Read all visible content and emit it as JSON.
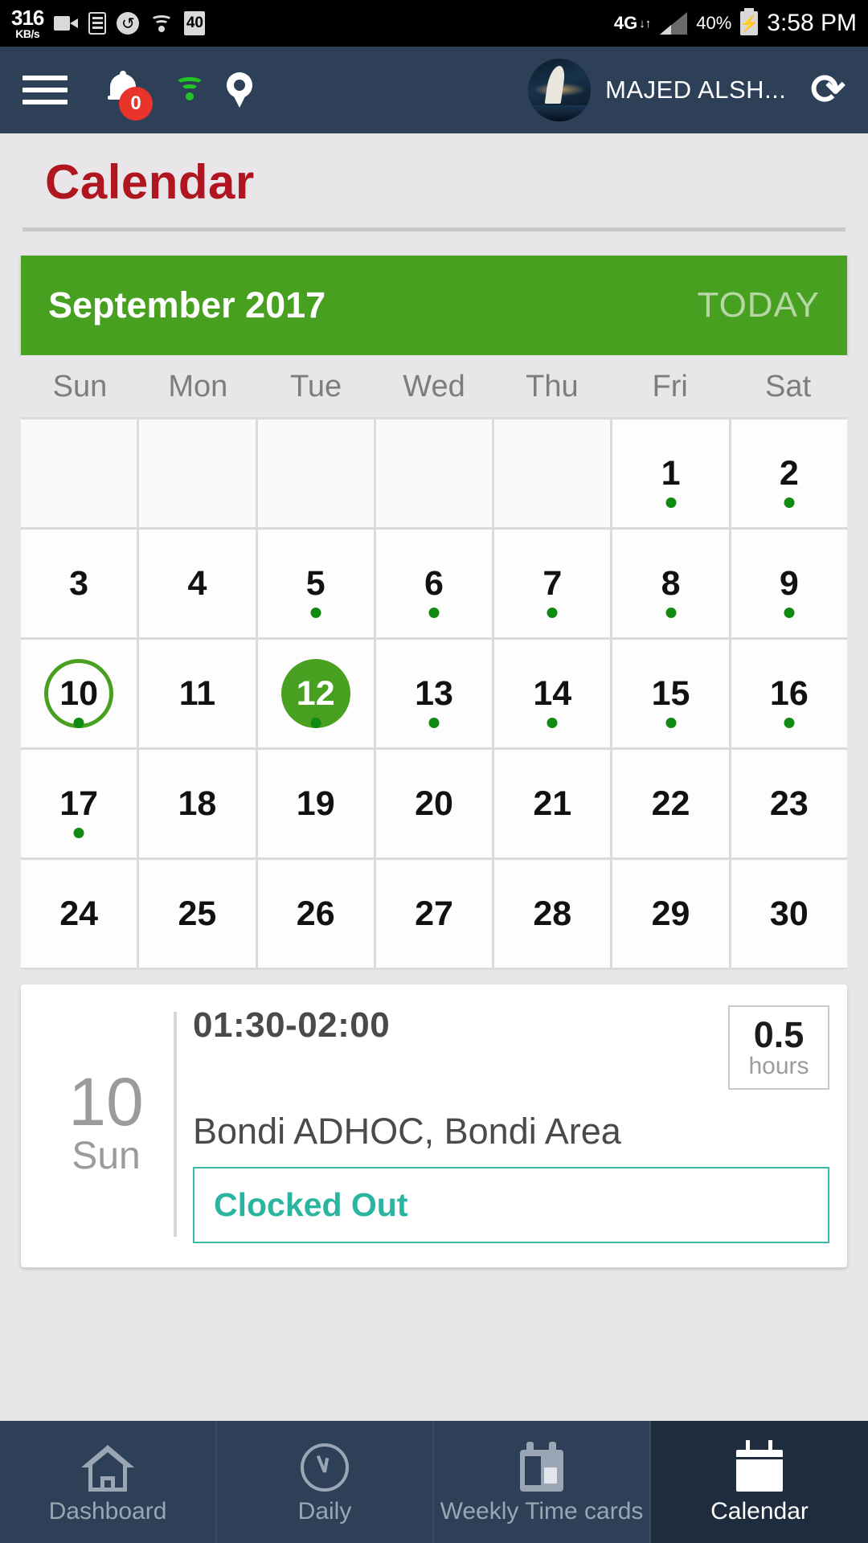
{
  "statusbar": {
    "net_speed_value": "316",
    "net_speed_unit": "KB/s",
    "icons": [
      "camera-icon",
      "list-icon",
      "sync-icon",
      "wifi-icon",
      "alarm-40-icon"
    ],
    "alarm_badge": "40",
    "network_type": "4G",
    "data_arrows": "↓↑",
    "battery_percent": "40%",
    "time": "3:58 PM"
  },
  "appbar": {
    "menu_icon": "hamburger-menu-icon",
    "notification_icon": "bell-icon",
    "notification_count": "0",
    "wifi_icon": "wifi-icon",
    "location_icon": "location-pin-icon",
    "user_name": "MAJED ALSH...",
    "avatar_icon": "user-avatar",
    "refresh_icon": "refresh-icon",
    "refresh_glyph": "⟳"
  },
  "page": {
    "title": "Calendar"
  },
  "calendar": {
    "month_label": "September 2017",
    "today_button": "TODAY",
    "weekdays": [
      "Sun",
      "Mon",
      "Tue",
      "Wed",
      "Thu",
      "Fri",
      "Sat"
    ],
    "accent_green": "#47a01f",
    "dot_green": "#108a10",
    "selected_day": "10",
    "today_day": "12",
    "weeks": [
      [
        {
          "day": "",
          "dot": false
        },
        {
          "day": "",
          "dot": false
        },
        {
          "day": "",
          "dot": false
        },
        {
          "day": "",
          "dot": false
        },
        {
          "day": "",
          "dot": false
        },
        {
          "day": "1",
          "dot": true
        },
        {
          "day": "2",
          "dot": true
        }
      ],
      [
        {
          "day": "3",
          "dot": false
        },
        {
          "day": "4",
          "dot": false
        },
        {
          "day": "5",
          "dot": true
        },
        {
          "day": "6",
          "dot": true
        },
        {
          "day": "7",
          "dot": true
        },
        {
          "day": "8",
          "dot": true
        },
        {
          "day": "9",
          "dot": true
        }
      ],
      [
        {
          "day": "10",
          "dot": true,
          "state": "selected"
        },
        {
          "day": "11",
          "dot": false
        },
        {
          "day": "12",
          "dot": true,
          "state": "today"
        },
        {
          "day": "13",
          "dot": true
        },
        {
          "day": "14",
          "dot": true
        },
        {
          "day": "15",
          "dot": true
        },
        {
          "day": "16",
          "dot": true
        }
      ],
      [
        {
          "day": "17",
          "dot": true
        },
        {
          "day": "18",
          "dot": false
        },
        {
          "day": "19",
          "dot": false
        },
        {
          "day": "20",
          "dot": false
        },
        {
          "day": "21",
          "dot": false
        },
        {
          "day": "22",
          "dot": false
        },
        {
          "day": "23",
          "dot": false
        }
      ],
      [
        {
          "day": "24",
          "dot": false
        },
        {
          "day": "25",
          "dot": false
        },
        {
          "day": "26",
          "dot": false
        },
        {
          "day": "27",
          "dot": false
        },
        {
          "day": "28",
          "dot": false
        },
        {
          "day": "29",
          "dot": false
        },
        {
          "day": "30",
          "dot": false
        }
      ]
    ]
  },
  "event": {
    "day_number": "10",
    "weekday": "Sun",
    "time_range": "01:30-02:00",
    "hours_value": "0.5",
    "hours_label": "hours",
    "location": "Bondi ADHOC, Bondi Area",
    "status": "Clocked Out",
    "status_color": "#2bb5a0"
  },
  "bottomnav": {
    "items": [
      {
        "label": "Dashboard",
        "icon": "home-icon",
        "active": false
      },
      {
        "label": "Daily",
        "icon": "clock-icon",
        "active": false
      },
      {
        "label": "Weekly Time cards",
        "icon": "timecard-icon",
        "active": false
      },
      {
        "label": "Calendar",
        "icon": "calendar-icon",
        "active": true
      }
    ]
  }
}
